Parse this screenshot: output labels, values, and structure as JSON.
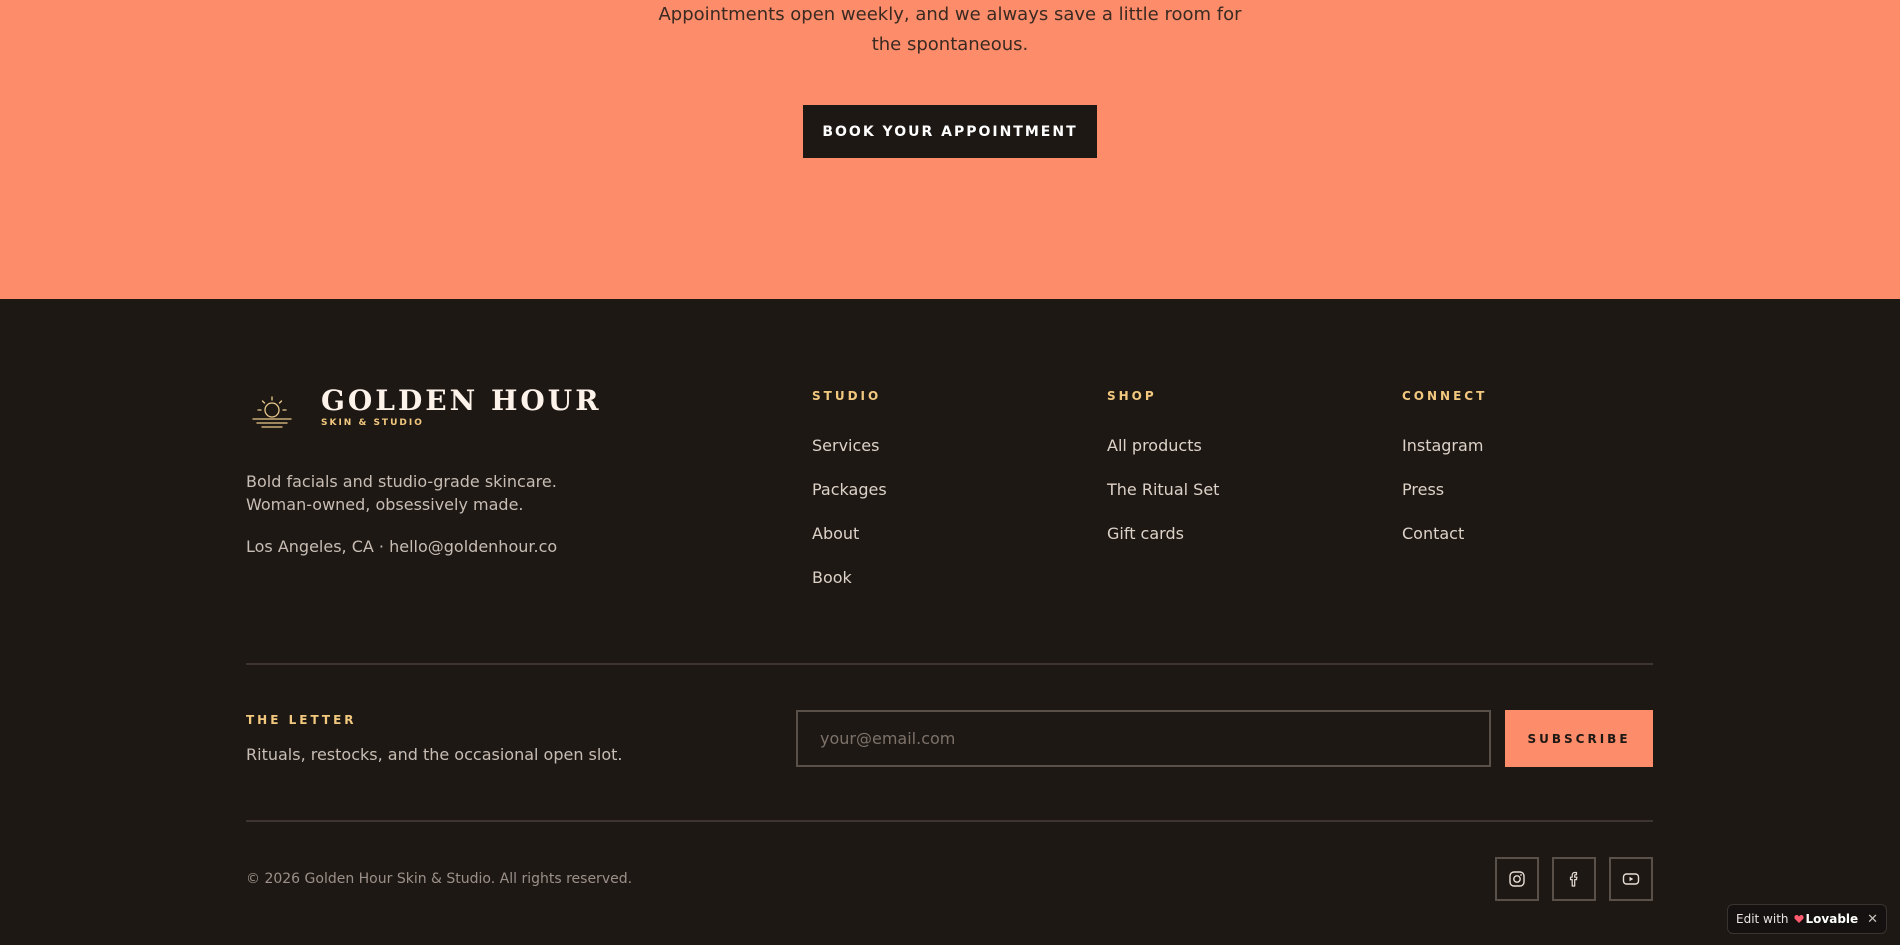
{
  "cta": {
    "text_line1": "Appointments open weekly, and we always save a little room for",
    "text_line2": "the spontaneous.",
    "button_label": "BOOK YOUR APPOINTMENT"
  },
  "brand": {
    "name": "GOLDEN HOUR",
    "subtitle": "SKIN & STUDIO",
    "logo_icon": "sun-icon",
    "description": "Bold facials and studio-grade skincare. Woman-owned, obsessively made.",
    "contact": "Los Angeles, CA · hello@goldenhour.co"
  },
  "columns": [
    {
      "heading": "STUDIO",
      "links": [
        "Services",
        "Packages",
        "About",
        "Book"
      ]
    },
    {
      "heading": "SHOP",
      "links": [
        "All products",
        "The Ritual Set",
        "Gift cards"
      ]
    },
    {
      "heading": "CONNECT",
      "links": [
        "Instagram",
        "Press",
        "Contact"
      ]
    }
  ],
  "newsletter": {
    "heading": "THE LETTER",
    "description": "Rituals, restocks, and the occasional open slot.",
    "placeholder": "your@email.com",
    "button_label": "SUBSCRIBE"
  },
  "bottom": {
    "copyright": "© 2026 Golden Hour Skin & Studio. All rights reserved.",
    "social": [
      "instagram-icon",
      "facebook-icon",
      "youtube-icon"
    ]
  },
  "badge": {
    "edit_with": "Edit with",
    "brand": "Lovable",
    "close": "✕"
  },
  "colors": {
    "cta_background": "#fc8c6a",
    "footer_background": "#1e1814",
    "accent_gold": "#f2c87f",
    "accent_coral": "#fc8c6a"
  }
}
